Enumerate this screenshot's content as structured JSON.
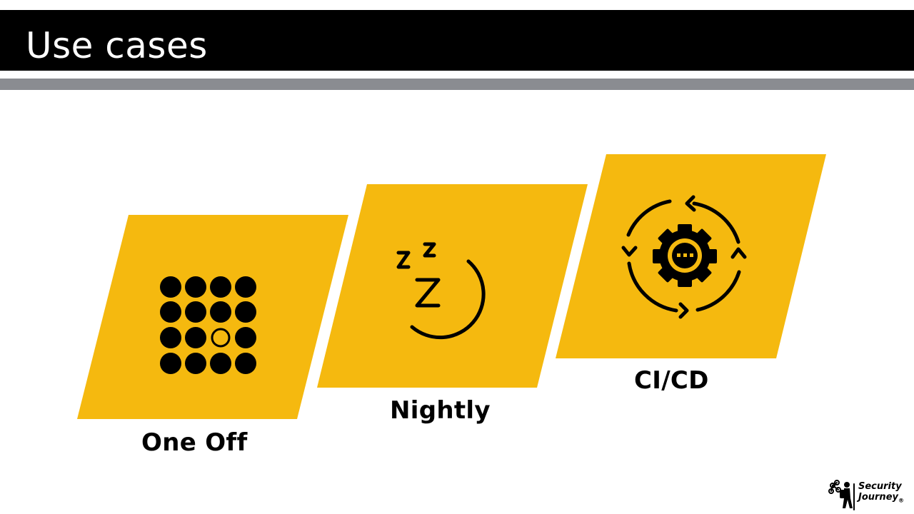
{
  "slide": {
    "title": "Use cases"
  },
  "cards": [
    {
      "label": "One Off",
      "icon": "grid-of-dots-icon"
    },
    {
      "label": "Nightly",
      "icon": "sleeping-moon-icon"
    },
    {
      "label": "CI/CD",
      "icon": "gear-cycle-icon"
    }
  ],
  "logo": {
    "line1": "Security",
    "line2": "Journey",
    "mark": "®"
  },
  "colors": {
    "card": "#F5B90F",
    "title_bar": "#000000",
    "rule": "#8A8C91"
  }
}
